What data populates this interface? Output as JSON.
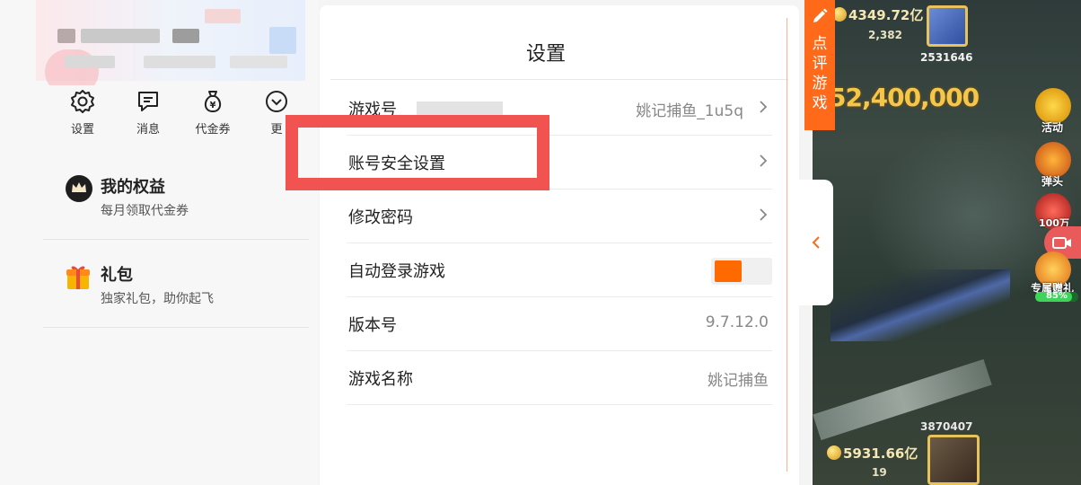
{
  "quick_actions": [
    {
      "label": "设置",
      "icon": "gear-icon"
    },
    {
      "label": "消息",
      "icon": "message-icon"
    },
    {
      "label": "代金券",
      "icon": "voucher-bag-icon"
    },
    {
      "label": "更",
      "icon": "chevron-down-circle-icon"
    }
  ],
  "benefits": {
    "title": "我的权益",
    "subtitle": "每月领取代金券",
    "icon": "crown-icon"
  },
  "gift": {
    "title": "礼包",
    "subtitle": "独家礼包，助你起飞",
    "icon": "gift-icon"
  },
  "settings": {
    "title": "设置",
    "rows": {
      "game_id": {
        "label": "游戏号",
        "value": "姚记捕鱼_1u5q"
      },
      "security": {
        "label": "账号安全设置"
      },
      "password": {
        "label": "修改密码"
      },
      "auto_login": {
        "label": "自动登录游戏",
        "enabled": true
      },
      "version": {
        "label": "版本号",
        "value": "9.7.12.0"
      },
      "game_name": {
        "label": "游戏名称",
        "value": "姚记捕鱼"
      }
    }
  },
  "side_tab": {
    "label": "点评游戏"
  },
  "game": {
    "top_coins": "4349.72亿",
    "top_count": "2,382",
    "top_player_id": "2531646",
    "big_number": "52,400,000",
    "labels": {
      "activity": "活动",
      "bullet": "弹头",
      "cannon": "100万",
      "gift": "专属赠礼",
      "gift_pct": "85%"
    },
    "bottom_player_id": "3870407",
    "bottom_coins": "5931.66亿",
    "bottom_count": "19"
  },
  "colors": {
    "accent": "#ff6a1a",
    "highlight": "#f05350",
    "toggle_on": "#ff6a00"
  }
}
